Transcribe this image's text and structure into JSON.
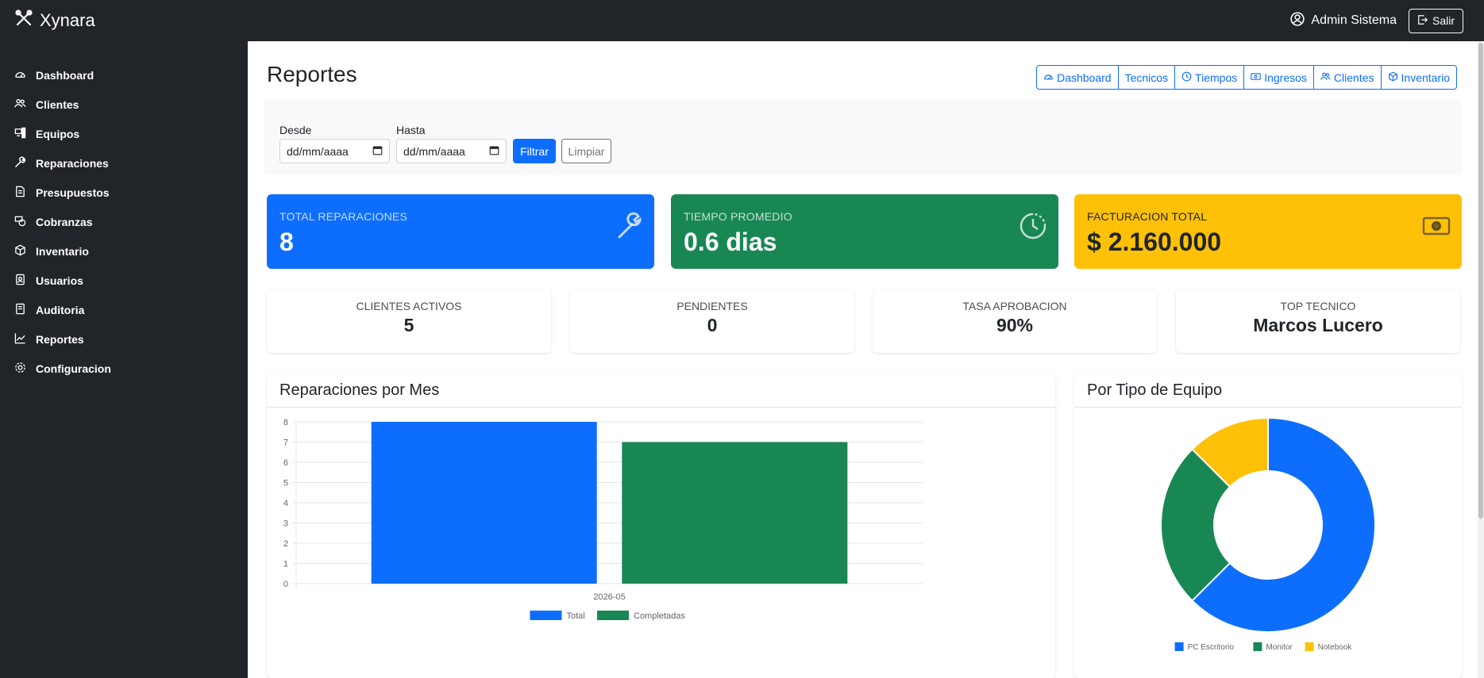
{
  "app": {
    "brand": "Xynara"
  },
  "navbar": {
    "user_name": "Admin Sistema",
    "logout_label": "Salir"
  },
  "sidebar": {
    "items": [
      {
        "label": "Dashboard",
        "icon": "speedometer-icon"
      },
      {
        "label": "Clientes",
        "icon": "people-icon"
      },
      {
        "label": "Equipos",
        "icon": "pc-display-icon"
      },
      {
        "label": "Reparaciones",
        "icon": "wrench-icon"
      },
      {
        "label": "Presupuestos",
        "icon": "file-text-icon"
      },
      {
        "label": "Cobranzas",
        "icon": "cash-coin-icon"
      },
      {
        "label": "Inventario",
        "icon": "box-icon"
      },
      {
        "label": "Usuarios",
        "icon": "person-badge-icon"
      },
      {
        "label": "Auditoria",
        "icon": "journal-icon"
      },
      {
        "label": "Reportes",
        "icon": "graph-up-icon"
      },
      {
        "label": "Configuracion",
        "icon": "gear-icon"
      }
    ]
  },
  "page": {
    "title": "Reportes",
    "report_tabs": [
      {
        "label": "Dashboard",
        "icon": "speedometer-icon"
      },
      {
        "label": "Tecnicos",
        "icon": ""
      },
      {
        "label": "Tiempos",
        "icon": "clock-icon"
      },
      {
        "label": "Ingresos",
        "icon": "cash-icon"
      },
      {
        "label": "Clientes",
        "icon": "people-icon"
      },
      {
        "label": "Inventario",
        "icon": "box-icon"
      }
    ]
  },
  "filter": {
    "from_label": "Desde",
    "from_placeholder": "dd/mm/aaaa",
    "to_label": "Hasta",
    "to_placeholder": "dd/mm/aaaa",
    "filter_button": "Filtrar",
    "clear_button": "Limpiar"
  },
  "kpis": [
    {
      "label": "TOTAL REPARACIONES",
      "value": "8",
      "icon": "wrench-icon",
      "color": "#0d6efd"
    },
    {
      "label": "TIEMPO PROMEDIO",
      "value": "0.6 dias",
      "icon": "clock-history-icon",
      "color": "#198754"
    },
    {
      "label": "FACTURACION TOTAL",
      "value": "$ 2.160.000",
      "icon": "cash-icon",
      "color": "#ffc107"
    }
  ],
  "stats": [
    {
      "label": "CLIENTES ACTIVOS",
      "value": "5"
    },
    {
      "label": "PENDIENTES",
      "value": "0"
    },
    {
      "label": "TASA APROBACION",
      "value": "90%"
    },
    {
      "label": "TOP TECNICO",
      "value": "Marcos Lucero"
    }
  ],
  "cards": {
    "monthly_title": "Reparaciones por Mes",
    "type_title": "Por Tipo de Equipo"
  },
  "chart_data": [
    {
      "type": "bar",
      "categories": [
        "2026-05"
      ],
      "series": [
        {
          "name": "Total",
          "values": [
            8
          ],
          "color": "#0d6efd"
        },
        {
          "name": "Completadas",
          "values": [
            7
          ],
          "color": "#198754"
        }
      ],
      "ylim": [
        0,
        8
      ],
      "yticks": [
        "0",
        "1",
        "2",
        "3",
        "4",
        "5",
        "6",
        "7",
        "8"
      ],
      "grid": true,
      "legend": "bottom"
    },
    {
      "type": "pie",
      "donut": true,
      "labels": [
        "PC Escritorio",
        "Monitor",
        "Notebook"
      ],
      "values": [
        5,
        2,
        1
      ],
      "colors": [
        "#0d6efd",
        "#198754",
        "#ffc107"
      ],
      "legend": "bottom"
    }
  ]
}
